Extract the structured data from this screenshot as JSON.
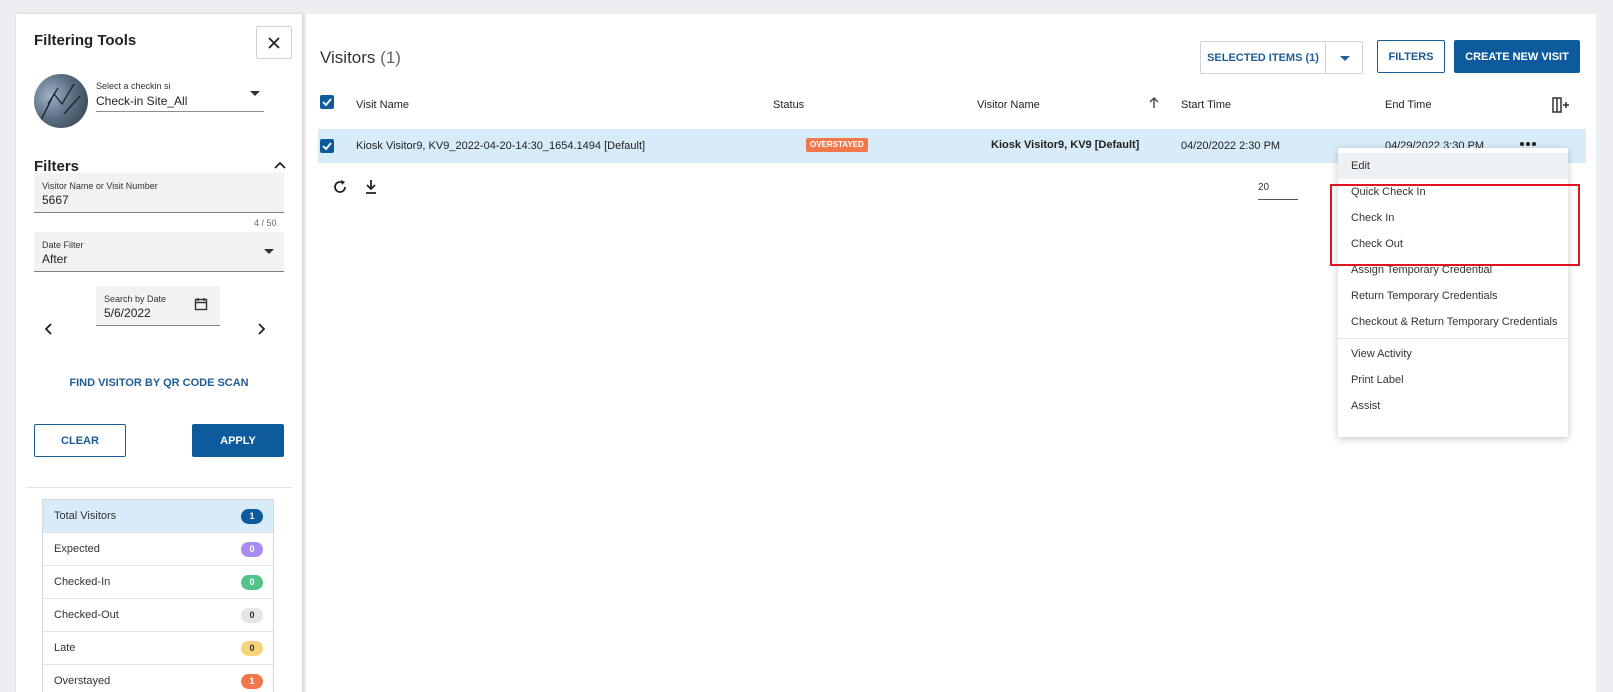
{
  "sidebar": {
    "title": "Filtering Tools",
    "site_select": {
      "label": "Select a checkin si",
      "value": "Check-in Site_All"
    },
    "filters_title": "Filters",
    "visitor_field": {
      "label": "Visitor Name or Visit Number",
      "value": "5667",
      "count": "4 / 50"
    },
    "date_filter": {
      "label": "Date Filter",
      "value": "After"
    },
    "search_date": {
      "label": "Search by Date",
      "value": "5/6/2022"
    },
    "qr_link": "FIND VISITOR BY QR CODE SCAN",
    "clear_label": "CLEAR",
    "apply_label": "APPLY",
    "stats": [
      {
        "label": "Total Visitors",
        "count": "1",
        "color": "#0d5a9c",
        "text": "#ffffff"
      },
      {
        "label": "Expected",
        "count": "0",
        "color": "#a98cf0",
        "text": "#ffffff"
      },
      {
        "label": "Checked-In",
        "count": "0",
        "color": "#52c48a",
        "text": "#ffffff"
      },
      {
        "label": "Checked-Out",
        "count": "0",
        "color": "#e3e5e8",
        "text": "#333333"
      },
      {
        "label": "Late",
        "count": "0",
        "color": "#f7d37a",
        "text": "#333333"
      },
      {
        "label": "Overstayed",
        "count": "1",
        "color": "#f2784b",
        "text": "#ffffff"
      }
    ]
  },
  "main": {
    "title": "Visitors",
    "title_count": "(1)",
    "selected_items_label": "SELECTED ITEMS (1)",
    "filters_label": "FILTERS",
    "create_label": "CREATE NEW VISIT",
    "columns": [
      "Visit Name",
      "Status",
      "Visitor Name",
      "Start Time",
      "End Time"
    ],
    "row": {
      "visit_name": "Kiosk Visitor9, KV9_2022-04-20-14:30_1654.1494 [Default]",
      "status": "OVERSTAYED",
      "visitor_name": "Kiosk Visitor9, KV9 [Default]",
      "start_time": "04/20/2022 2:30 PM",
      "end_time": "04/29/2022 3:30 PM"
    },
    "page_size": "20"
  },
  "menu": {
    "items": [
      "Edit",
      "Quick Check In",
      "Check In",
      "Check Out",
      "Assign Temporary Credential",
      "Return Temporary Credentials",
      "Checkout & Return Temporary Credentials",
      "View Activity",
      "Print Label",
      "Assist"
    ]
  },
  "colors": {
    "accent": "#0d5a9c",
    "highlight": "#e0141e",
    "row_selected": "#d8ebf8"
  }
}
